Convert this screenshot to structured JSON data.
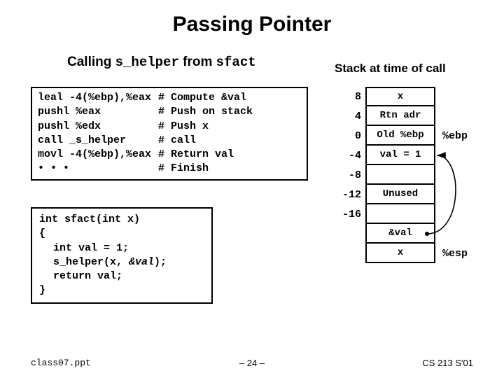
{
  "title": "Passing Pointer",
  "subtitle_pre": "Calling ",
  "subtitle_fn1": "s_helper",
  "subtitle_mid": " from ",
  "subtitle_fn2": "sfact",
  "stack_caption": "Stack at time of call",
  "asm": [
    {
      "instr": "leal -4(%ebp),%eax",
      "cmt": "Compute &val"
    },
    {
      "instr": "pushl %eax",
      "cmt": "Push on stack"
    },
    {
      "instr": "pushl %edx",
      "cmt": "Push x"
    },
    {
      "instr": "call _s_helper",
      "cmt": "call"
    },
    {
      "instr": "movl -4(%ebp),%eax",
      "cmt": "Return val"
    },
    {
      "instr": "• • •",
      "cmt": "Finish"
    }
  ],
  "code": {
    "l0": "int sfact(int x)",
    "l1": "{",
    "l2": "int val = 1;",
    "l3a": "s_helper(x, ",
    "l3b": "&val",
    "l3c": ");",
    "l4": "return val;",
    "l5": "}"
  },
  "stack": [
    {
      "off": "8",
      "val": "x"
    },
    {
      "off": "4",
      "val": "Rtn adr"
    },
    {
      "off": "0",
      "val": "Old %ebp"
    },
    {
      "off": "-4",
      "val": "val = 1"
    },
    {
      "off": "-8",
      "val": ""
    },
    {
      "off": "-12",
      "val": "Unused"
    },
    {
      "off": "-16",
      "val": ""
    },
    {
      "off": "",
      "val": "&val"
    },
    {
      "off": "",
      "val": "x"
    }
  ],
  "ptr_ebp": "%ebp",
  "ptr_esp": "%esp",
  "footer": {
    "left": "class07.ppt",
    "mid": "– 24 –",
    "right": "CS 213 S'01"
  }
}
